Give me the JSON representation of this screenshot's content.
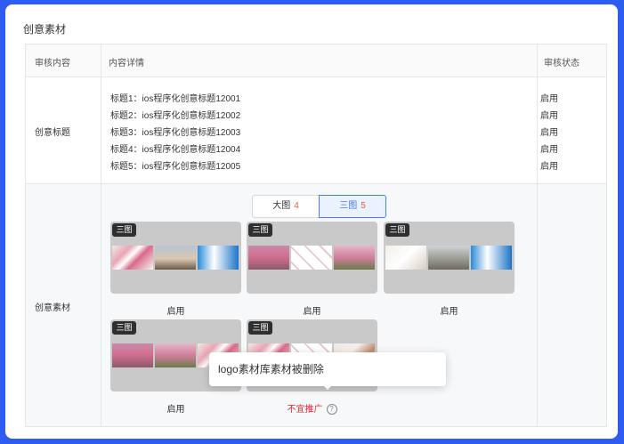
{
  "section_title": "创意素材",
  "table": {
    "headers": [
      "审核内容",
      "内容详情",
      "审核状态"
    ],
    "rows": [
      {
        "label": "创意标题",
        "titles": [
          {
            "text": "标题1：ios程序化创意标题12001",
            "status": "启用"
          },
          {
            "text": "标题2：ios程序化创意标题12002",
            "status": "启用"
          },
          {
            "text": "标题3：ios程序化创意标题12003",
            "status": "启用"
          },
          {
            "text": "标题4：ios程序化创意标题12004",
            "status": "启用"
          },
          {
            "text": "标题5：ios程序化创意标题12005",
            "status": "启用"
          }
        ]
      },
      {
        "label": "创意素材",
        "tabs": [
          {
            "label": "大图",
            "count": "4"
          },
          {
            "label": "三图",
            "count": "5"
          }
        ],
        "cards": [
          {
            "badge": "三图",
            "status": "启用",
            "thumbs": [
              "flower",
              "sky",
              "ad"
            ]
          },
          {
            "badge": "三图",
            "status": "启用",
            "thumbs": [
              "blossom",
              "pattern",
              "orchard"
            ]
          },
          {
            "badge": "三图",
            "status": "启用",
            "thumbs": [
              "desk",
              "city",
              "ad"
            ]
          },
          {
            "badge": "三图",
            "status": "启用",
            "thumbs": [
              "blossom",
              "orchard",
              "flower"
            ]
          },
          {
            "badge": "三图",
            "status": "不宜推广",
            "thumbs": [
              "flower",
              "pattern",
              "branch"
            ]
          }
        ],
        "help_icon": "question-circle-icon",
        "tooltip": "logo素材库素材被删除"
      }
    ]
  },
  "colors": {
    "background_frame": "#2f5cf0",
    "active_tab": "#4a7cf5",
    "count": "#f25b2a",
    "rejected": "#f5222d"
  }
}
